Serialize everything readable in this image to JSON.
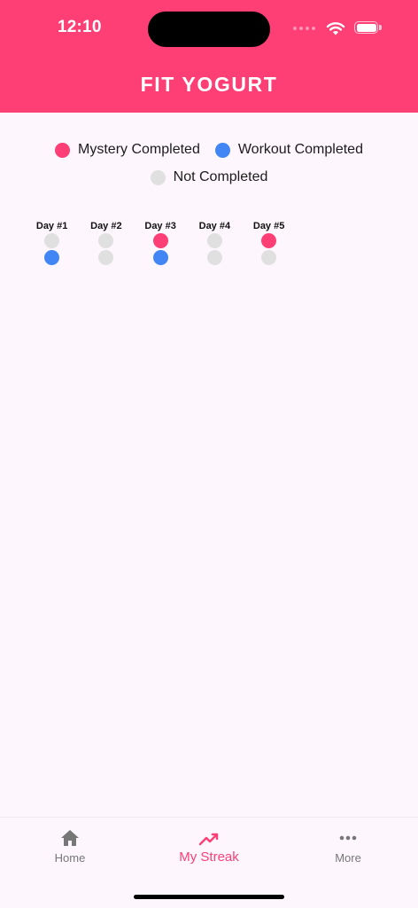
{
  "status_bar": {
    "time": "12:10"
  },
  "header": {
    "title": "FIT YOGURT",
    "color": "#fd3f76"
  },
  "legend": {
    "mystery_label": "Mystery Completed",
    "workout_label": "Workout Completed",
    "not_completed_label": "Not Completed",
    "mystery_color": "#fd3f76",
    "workout_color": "#4285f4",
    "not_completed_color": "#e0e0e0"
  },
  "days": [
    {
      "label": "Day #1",
      "mystery": false,
      "workout": true
    },
    {
      "label": "Day #2",
      "mystery": false,
      "workout": false
    },
    {
      "label": "Day #3",
      "mystery": true,
      "workout": true
    },
    {
      "label": "Day #4",
      "mystery": false,
      "workout": false
    },
    {
      "label": "Day #5",
      "mystery": true,
      "workout": false
    }
  ],
  "bottom_nav": {
    "items": [
      {
        "label": "Home",
        "icon": "home-icon",
        "active": false
      },
      {
        "label": "My Streak",
        "icon": "trending-up-icon",
        "active": true
      },
      {
        "label": "More",
        "icon": "more-horizontal-icon",
        "active": false
      }
    ],
    "active_color": "#fd3f76",
    "inactive_color": "#777777"
  }
}
